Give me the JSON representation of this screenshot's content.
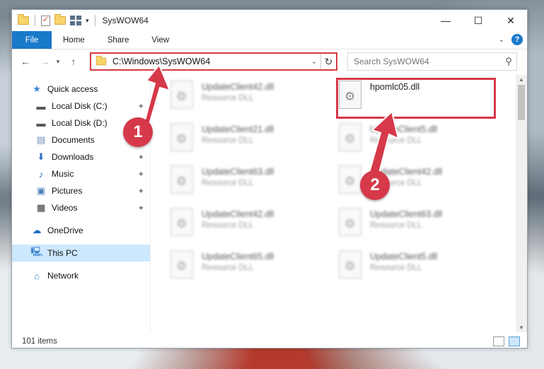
{
  "window": {
    "title": "SysWOW64"
  },
  "ribbon": {
    "tabs": [
      {
        "label": "File"
      },
      {
        "label": "Home"
      },
      {
        "label": "Share"
      },
      {
        "label": "View"
      }
    ]
  },
  "address": {
    "path": "C:\\Windows\\SysWOW64"
  },
  "search": {
    "placeholder": "Search SysWOW64"
  },
  "sidebar": {
    "items": [
      {
        "label": "Quick access"
      },
      {
        "label": "Local Disk (C:)"
      },
      {
        "label": "Local Disk (D:)"
      },
      {
        "label": "Documents"
      },
      {
        "label": "Downloads"
      },
      {
        "label": "Music"
      },
      {
        "label": "Pictures"
      },
      {
        "label": "Videos"
      },
      {
        "label": "OneDrive"
      },
      {
        "label": "This PC"
      },
      {
        "label": "Network"
      }
    ]
  },
  "files": [
    {
      "name": "UpdateClient42.dll",
      "type": "Resource DLL"
    },
    {
      "name": "hpomlc05.dll",
      "type": ""
    },
    {
      "name": "UpdateClient21.dll",
      "type": "Resource DLL"
    },
    {
      "name": "UpdateClient5.dll",
      "type": "Resource DLL"
    },
    {
      "name": "UpdateClient63.dll",
      "type": "Resource DLL"
    },
    {
      "name": "UpdateClient42.dll",
      "type": "Resource DLL"
    },
    {
      "name": "UpdateClient42.dll",
      "type": "Resource DLL"
    },
    {
      "name": "UpdateClient63.dll",
      "type": "Resource DLL"
    },
    {
      "name": "UpdateClient65.dll",
      "type": "Resource DLL"
    },
    {
      "name": "UpdateClient5.dll",
      "type": "Resource DLL"
    }
  ],
  "status": {
    "count": "101 items"
  },
  "annotations": {
    "step1": "1",
    "step2": "2",
    "accent": "#d6394a"
  }
}
